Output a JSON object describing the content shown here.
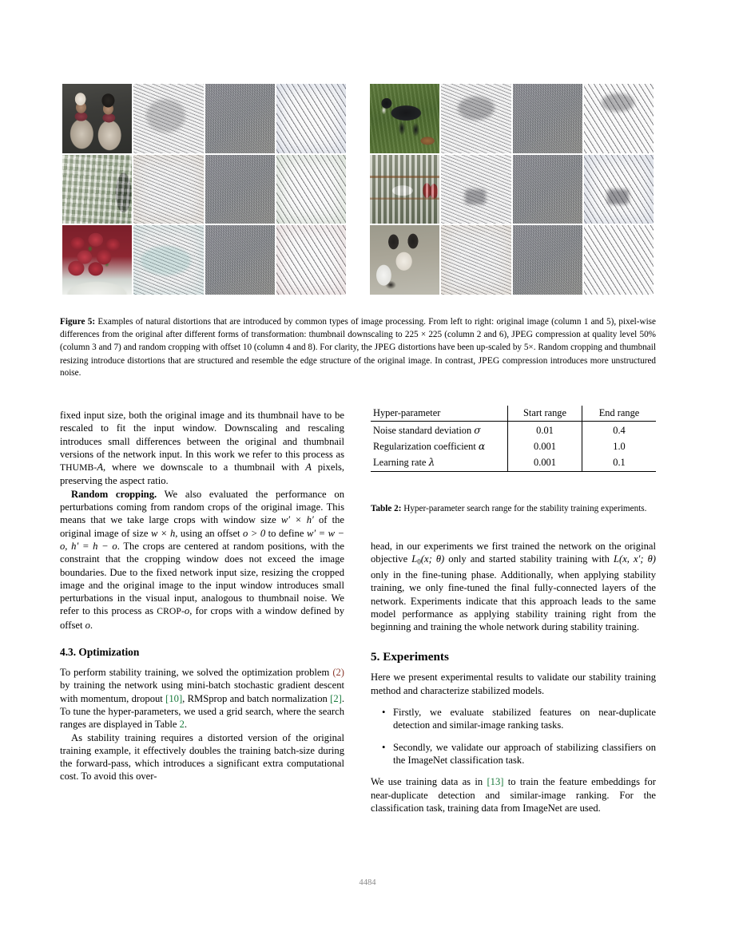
{
  "figure": {
    "label": "Figure 5:",
    "caption_part1": " Examples of natural distortions that are introduced by common types of image processing. From left to right: original image (column 1 and 5), pixel-wise differences from the original after different forms of transformation: thumbnail downscaling to 225 × 225 (column 2 and 6), ",
    "caption_jpeg1": "JPEG",
    "caption_part2": " compression at quality level 50% (column 3 and 7) and random cropping with offset 10 (column 4 and 8). For clarity, the ",
    "caption_jpeg2": "JPEG",
    "caption_part3": " distortions have been up-scaled by 5×. Random cropping and thumbnail resizing introduce distortions that are structured and resemble the edge structure of the original image. In contrast, ",
    "caption_jpeg3": "JPEG",
    "caption_part4": " compression introduces more unstructured noise.",
    "left_block": {
      "rows": [
        {
          "original": "two-men-in-hats-photo",
          "thumb_diff": "thumbnail-difference-noise",
          "jpeg_diff": "jpeg-difference-noise",
          "crop_diff": "crop-difference-noise"
        },
        {
          "original": "market-shelf-photo",
          "thumb_diff": "thumbnail-difference-noise",
          "jpeg_diff": "jpeg-difference-noise",
          "crop_diff": "crop-difference-noise"
        },
        {
          "original": "strawberries-in-bowl-photo",
          "thumb_diff": "thumbnail-difference-noise",
          "jpeg_diff": "jpeg-difference-noise",
          "crop_diff": "crop-difference-noise"
        }
      ]
    },
    "right_block": {
      "rows": [
        {
          "original": "black-and-white-dog-on-grass-photo",
          "thumb_diff": "thumbnail-difference-noise",
          "jpeg_diff": "jpeg-difference-noise",
          "crop_diff": "crop-difference-noise"
        },
        {
          "original": "bottle-shelves-photo",
          "thumb_diff": "thumbnail-difference-noise",
          "jpeg_diff": "jpeg-difference-noise",
          "crop_diff": "crop-difference-noise"
        },
        {
          "original": "papillon-dog-photo",
          "thumb_diff": "thumbnail-difference-noise",
          "jpeg_diff": "jpeg-difference-noise",
          "crop_diff": "crop-difference-noise"
        }
      ]
    }
  },
  "left_column": {
    "para_continued": "fixed input size, both the original image and its thumbnail have to be rescaled to fit the input window. Downscaling and rescaling introduces small differences between the original and thumbnail versions of the network input. In this work we refer to this process as ",
    "thumb_term": "THUMB-",
    "thumb_term_var": "A",
    "para_continued_end": ", where we downscale to a thumbnail with ",
    "thumb_var2": "A",
    "para_continued_end2": " pixels, preserving the aspect ratio.",
    "crop_runin": "Random cropping.",
    "crop_text_1": " We also evaluated the performance on perturbations coming from random crops of the original image. This means that we take large crops with window size ",
    "crop_math_1": "w′ × h′",
    "crop_text_2": " of the original image of size ",
    "crop_math_2": "w × h",
    "crop_text_3": ", using an offset ",
    "crop_math_3": "o > 0",
    "crop_text_4": " to define ",
    "crop_math_4": "w′ = w − o, h′ = h − o",
    "crop_text_5": ". The crops are centered at random positions, with the constraint that the cropping window does not exceed the image boundaries. Due to the fixed network input size, resizing the cropped image and the original image to the input window introduces small perturbations in the visual input, analogous to thumbnail noise. We refer to this process as ",
    "crop_term": "CROP-",
    "crop_term_var": "o",
    "crop_text_6": ", for crops with a window defined by offset ",
    "crop_var_last": "o",
    "crop_text_7": ".",
    "section_heading": "4.3. Optimization",
    "opt_text_1": "To perform stability training, we solved the optimization problem ",
    "opt_ref_eq": "(2)",
    "opt_text_2": " by training the network using mini-batch stochastic gradient descent with momentum, dropout ",
    "opt_ref_10": "[10]",
    "opt_text_3": ", RMSprop and batch normalization ",
    "opt_ref_2": "[2]",
    "opt_text_4": ". To tune the hyper-parameters, we used a grid search, where the search ranges are displayed in Table ",
    "opt_ref_tbl": "2",
    "opt_text_5": ".",
    "doubling_text": "As stability training requires a distorted version of the original training example, it effectively doubles the training batch-size during the forward-pass, which introduces a significant extra computational cost. To avoid this over-"
  },
  "table": {
    "label": "Table 2:",
    "caption": " Hyper-parameter search range for the stability training experiments.",
    "headers": [
      "Hyper-parameter",
      "Start range",
      "End range"
    ],
    "rows": [
      {
        "name": "Noise standard deviation ",
        "symbol": "σ",
        "start": "0.01",
        "end": "0.4"
      },
      {
        "name": "Regularization coefficient ",
        "symbol": "α",
        "start": "0.001",
        "end": "1.0"
      },
      {
        "name": "Learning rate ",
        "symbol": "λ",
        "start": "0.001",
        "end": "0.1"
      }
    ]
  },
  "right_column": {
    "head_text_1": "head, in our experiments we first trained the network on the original objective ",
    "head_math_L0": "L",
    "head_math_L0_sub": "0",
    "head_math_L0_args": "(x; θ)",
    "head_text_2": " only and started stability training with ",
    "head_math_L": "L",
    "head_math_L_args": "(x, x′; θ)",
    "head_text_3": " only in the fine-tuning phase. Additionally, when applying stability training, we only fine-tuned the final fully-connected layers of the network. Experiments indicate that this approach leads to the same model performance as applying stability training right from the beginning and training the whole network during stability training.",
    "section_heading": "5. Experiments",
    "intro": "Here we present experimental results to validate our stability training method and characterize stabilized models.",
    "bullets": [
      "Firstly, we evaluate stabilized features on near-duplicate detection and similar-image ranking tasks.",
      "Secondly, we validate our approach of stabilizing classifiers on the ImageNet classification task."
    ],
    "closing_text_1": "We use training data as in ",
    "closing_ref": "[13]",
    "closing_text_2": " to train the feature embeddings for near-duplicate detection and similar-image ranking. For the classification task, training data from ImageNet are used."
  },
  "page_number": "4484",
  "colors": {
    "citation_green": "#1a7a3c",
    "equation_ref_red": "#8c3a2e",
    "page_number_gray": "#8a8a8a",
    "text_black": "#000000",
    "page_background": "#ffffff"
  }
}
